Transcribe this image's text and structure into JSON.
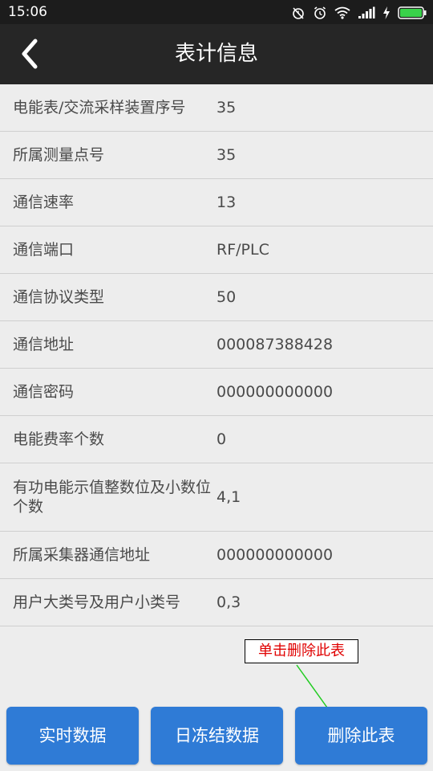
{
  "status_bar": {
    "time": "15:06",
    "icons": [
      "alarm-off-icon",
      "alarm-clock-icon",
      "wifi-icon",
      "signal-icon",
      "charging-icon",
      "battery-icon"
    ]
  },
  "header": {
    "title": "表计信息",
    "back_icon": "chevron-left-icon"
  },
  "info_rows": [
    {
      "label": "电能表/交流采样装置序号",
      "value": "35"
    },
    {
      "label": "所属测量点号",
      "value": "35"
    },
    {
      "label": "通信速率",
      "value": "13"
    },
    {
      "label": "通信端口",
      "value": "RF/PLC"
    },
    {
      "label": "通信协议类型",
      "value": "50"
    },
    {
      "label": "通信地址",
      "value": "000087388428"
    },
    {
      "label": "通信密码",
      "value": "000000000000"
    },
    {
      "label": "电能费率个数",
      "value": "0"
    },
    {
      "label": "有功电能示值整数位及小数位个数",
      "value": "4,1"
    },
    {
      "label": "所属采集器通信地址",
      "value": "000000000000"
    },
    {
      "label": "用户大类号及用户小类号",
      "value": "0,3"
    }
  ],
  "annotation": {
    "text": "单击删除此表",
    "text_color": "#e00000",
    "arrow_color": "#22cc22"
  },
  "buttons": {
    "realtime_label": "实时数据",
    "daily_frozen_label": "日冻结数据",
    "delete_label": "删除此表",
    "color": "#2f7bd6"
  }
}
